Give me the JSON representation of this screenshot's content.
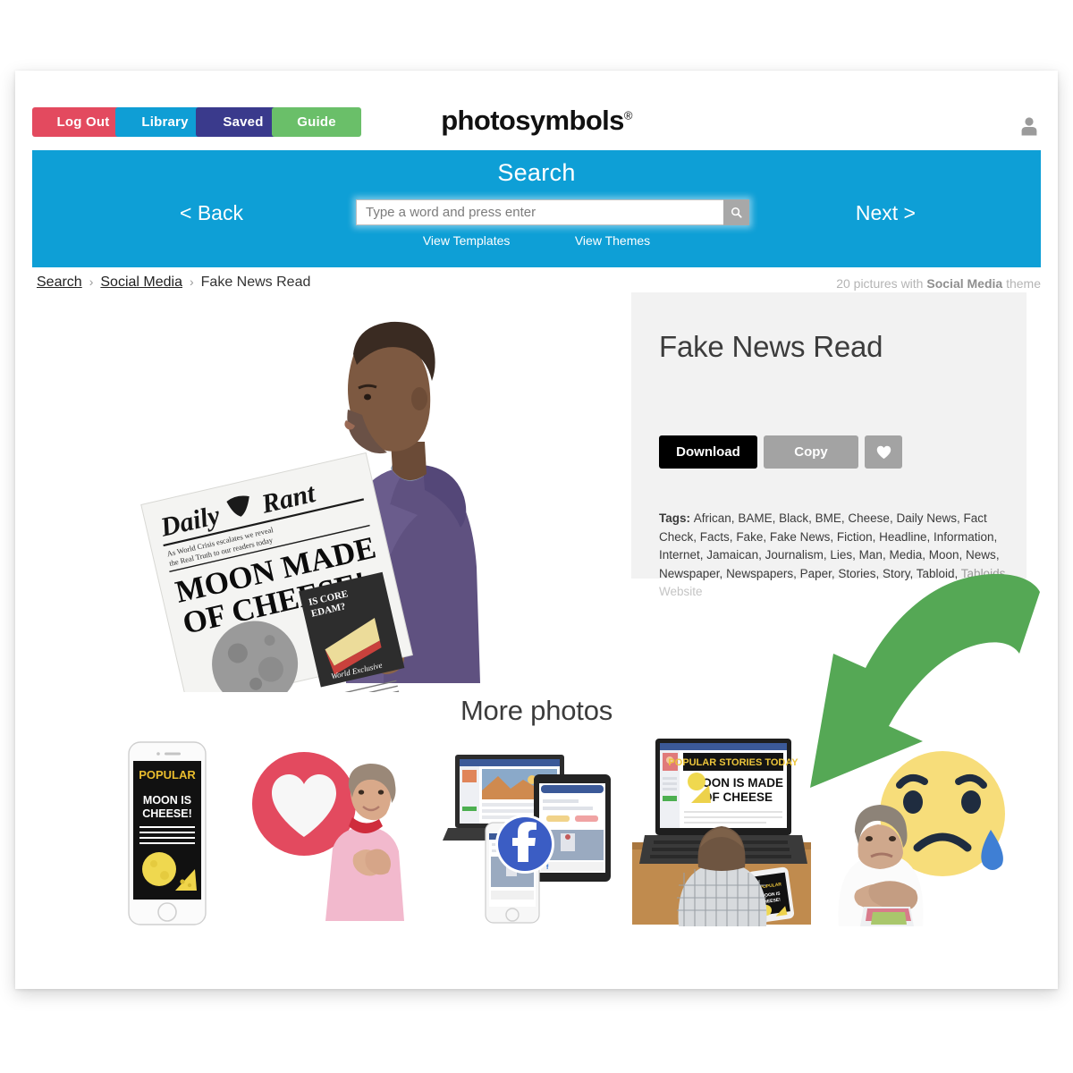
{
  "header": {
    "nav_buttons": [
      {
        "label": "Log Out",
        "color": "#e34a5f",
        "name": "log-out-button"
      },
      {
        "label": "Library",
        "color": "#0f9ed5",
        "name": "library-button"
      },
      {
        "label": "Saved",
        "color": "#3a3a8c",
        "name": "saved-button"
      },
      {
        "label": "Guide",
        "color": "#6abf69",
        "name": "guide-button"
      }
    ],
    "logo_text": "photosymbols",
    "logo_registered": "®",
    "account_icon": "user-avatar-icon"
  },
  "search_band": {
    "title": "Search",
    "back_label": "< Back",
    "next_label": "Next >",
    "placeholder": "Type a word and press enter",
    "input_value": "",
    "submit_icon": "search-icon",
    "sub_links": [
      {
        "label": "View Templates"
      },
      {
        "label": "View Themes"
      }
    ],
    "background": "#0e9fd6"
  },
  "breadcrumb": {
    "items": [
      {
        "label": "Search",
        "link": true
      },
      {
        "label": "Social Media",
        "link": true
      },
      {
        "label": "Fake News Read",
        "link": false
      }
    ],
    "separator": "›"
  },
  "theme_count": {
    "prefix": "20 pictures with ",
    "theme": "Social Media",
    "suffix": " theme"
  },
  "hero": {
    "alt": "Man reading Daily Rant newspaper with headline Moon Made of Cheese",
    "newspaper": {
      "masthead": "Daily Rant",
      "strapline": "As World Crisis escalates we reveal the Real Truth to our readers today",
      "headline": "MOON MADE OF CHEESE!",
      "inset_headline": "IS CORE EDAM?",
      "inset_footer": "World Exclusive"
    }
  },
  "info_panel": {
    "title": "Fake News Read",
    "buttons": {
      "download": "Download",
      "copy": "Copy",
      "favourite_icon": "heart-icon"
    },
    "tags_label": "Tags:",
    "tags": [
      "African",
      "BAME",
      "Black",
      "BME",
      "Cheese",
      "Daily News",
      "Fact Check",
      "Facts",
      "Fake",
      "Fake News",
      "Fiction",
      "Headline",
      "Information",
      "Internet",
      "Jamaican",
      "Journalism",
      "Lies",
      "Man",
      "Media",
      "Moon",
      "News",
      "Newspaper",
      "Newspapers",
      "Paper",
      "Stories",
      "Story",
      "Tabloid",
      "Tabloids",
      "Website"
    ],
    "faded_tags": [
      "Tabloids",
      "Website"
    ]
  },
  "annotation": {
    "arrow_icon": "curved-down-left-arrow-icon",
    "arrow_color": "#55a855"
  },
  "more_photos": {
    "title": "More photos",
    "thumbnails": [
      {
        "name": "thumbnail-phone-popular-moon-is-cheese",
        "caption_top": "POPULAR",
        "caption_main": "MOON IS CHEESE!"
      },
      {
        "name": "thumbnail-heart-woman-happy",
        "caption_top": "",
        "caption_main": ""
      },
      {
        "name": "thumbnail-facebook-devices",
        "caption_top": "",
        "caption_main": ""
      },
      {
        "name": "thumbnail-man-laptop-popular-stories",
        "caption_top": "POPULAR STORIES TODAY",
        "caption_main": "MOON IS MADE OF CHEESE"
      },
      {
        "name": "thumbnail-sad-emoji-woman",
        "caption_top": "",
        "caption_main": ""
      }
    ]
  }
}
